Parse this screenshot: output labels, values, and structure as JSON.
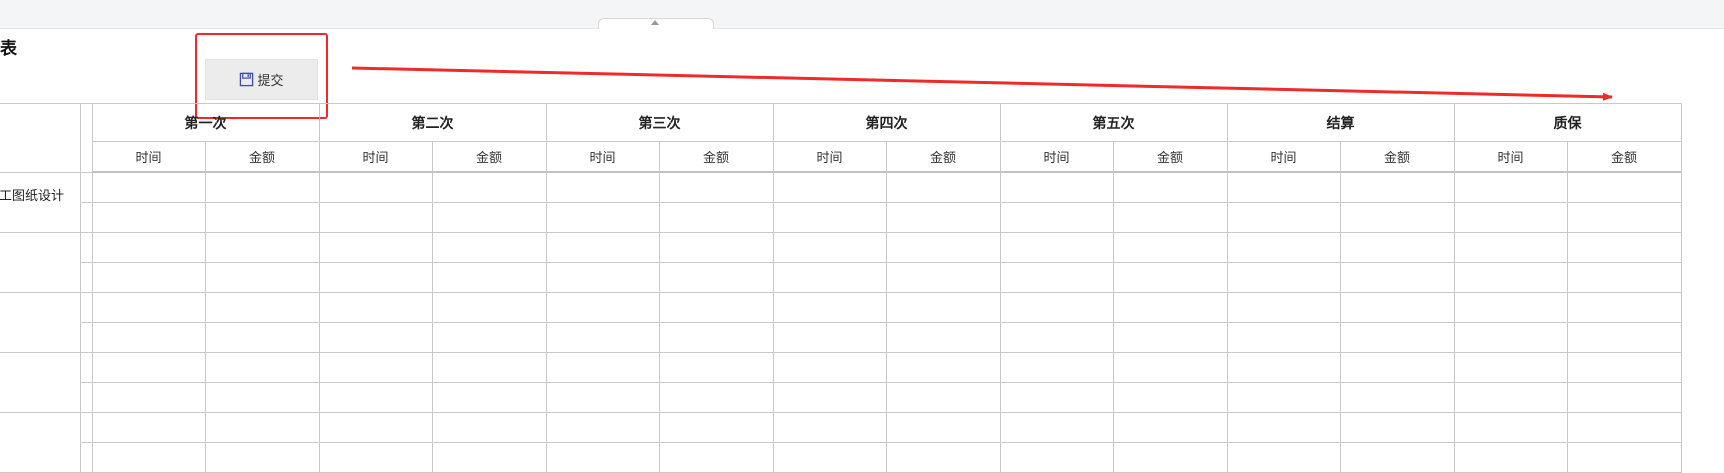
{
  "page": {
    "title": "表"
  },
  "toolbar": {
    "submit_label": "提交"
  },
  "table": {
    "groups": [
      "第一次",
      "第二次",
      "第三次",
      "第四次",
      "第五次",
      "结算",
      "质保"
    ],
    "sub_headers": [
      "时间",
      "金额"
    ],
    "row_labels": [
      "工图纸设计",
      "",
      "",
      "",
      ""
    ]
  },
  "annotation": {
    "color": "#ee2a2a"
  }
}
